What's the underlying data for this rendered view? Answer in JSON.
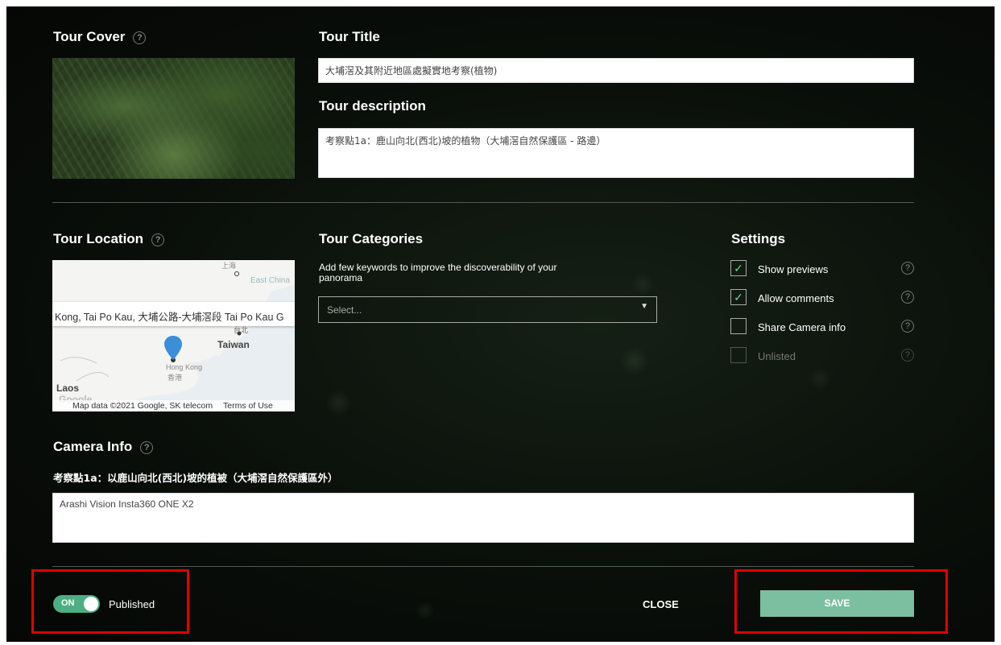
{
  "cover": {
    "heading": "Tour Cover",
    "help": "?"
  },
  "title_section": {
    "heading": "Tour Title",
    "value": "大埔滘及其附近地區處擬實地考察(植物)"
  },
  "description": {
    "heading": "Tour description",
    "value": "考察點1a：鹿山向北(西北)坡的植物（大埔滘自然保護區 - 路邊）"
  },
  "location": {
    "heading": "Tour Location",
    "help": "?",
    "map_address": "Kong, Tai Po Kau, 大埔公路-大埔滘段 Tai Po Kau G",
    "map_labels": {
      "shanghai": "上海",
      "east_china": "East China",
      "taibei": "台北",
      "taiwan": "Taiwan",
      "hongkong": "Hong Kong",
      "hongkong_cn": "香港",
      "laos": "Laos",
      "google": "Google",
      "attribution": "Map data ©2021 Google, SK telecom",
      "terms": "Terms of Use"
    }
  },
  "categories": {
    "heading": "Tour Categories",
    "hint": "Add few keywords to improve the discoverability of your panorama",
    "placeholder": "Select..."
  },
  "settings": {
    "heading": "Settings",
    "items": [
      {
        "label": "Show previews",
        "checked": "✓",
        "help": "?"
      },
      {
        "label": "Allow comments",
        "checked": "✓",
        "help": "?"
      },
      {
        "label": "Share Camera info",
        "checked": "",
        "help": "?"
      },
      {
        "label": "Unlisted",
        "checked": "",
        "help": "?"
      }
    ]
  },
  "camera": {
    "heading": "Camera Info",
    "help": "?",
    "caption": "考察點1a：以鹿山向北(西北)坡的植被（大埔滘自然保護區外）",
    "value": "Arashi Vision Insta360 ONE X2"
  },
  "footer": {
    "toggle_label": "ON",
    "published_label": "Published",
    "close_label": "CLOSE",
    "save_label": "SAVE"
  },
  "colors": {
    "accent": "#4caf83",
    "save_button": "#7bbfa0",
    "highlight": "#e00000"
  }
}
